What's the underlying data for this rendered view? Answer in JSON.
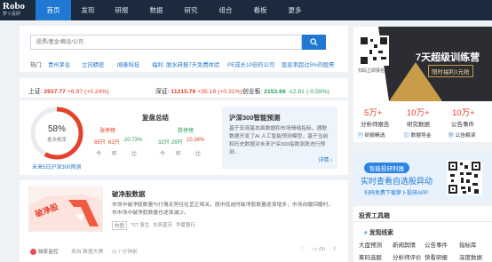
{
  "logo": {
    "text": "Robo",
    "sub": "萝卜投研"
  },
  "nav": {
    "items": [
      "首页",
      "发现",
      "研报",
      "数据",
      "研究",
      "组合",
      "看板",
      "更多"
    ],
    "active": 0
  },
  "search": {
    "placeholder": "股票/基金/概念/公司"
  },
  "hot": {
    "label": "热门:",
    "links": [
      "贵州茅台",
      "立讯精密",
      "闻泰科技",
      "福利: 脱水研报7天免费体验",
      "PE成长10倍的公司",
      "股息率超过5%的股票"
    ]
  },
  "indices": [
    {
      "name": "上证:",
      "value": "2937.77",
      "change": "+6.97",
      "pct": "(+0.24%)",
      "dir": "up"
    },
    {
      "name": "深证:",
      "value": "11215.76",
      "change": "+35.16",
      "pct": "(+0.31%)",
      "dir": "up"
    },
    {
      "name": "创业板:",
      "value": "2153.66",
      "change": "-12.81",
      "pct": "(-0.59%)",
      "dir": "down"
    }
  ],
  "gauge": {
    "percent": 58,
    "percent_text": "58%",
    "label": "看多概率",
    "footer": "未来5日沪深300预测",
    "arc_color": "#e5412c"
  },
  "review": {
    "title": "复盘总结",
    "up_label": "涨停榜",
    "up_value": "65只",
    "up_pct_label": "61只",
    "up_change": "-20.73%",
    "down_label": "跌停榜",
    "down_value": "32只",
    "down_pct_label": "29只",
    "down_change": "10.34%",
    "col_labels": [
      "今",
      "昨",
      "比",
      "今",
      "昨",
      "比"
    ]
  },
  "prediction": {
    "title": "沪深300智能预测",
    "text": "基于宏观基本面数据和市场情绪指标，通联数据开发了AI 人工智能预测模型，基于当前和历史数据对未来沪深300指数涨跌进行预测...",
    "more": "详情"
  },
  "news": {
    "image_text": "破净股",
    "title": "破净股数据",
    "text": "市场中破净股数量与行情走势往往呈正相关，股市低迷时破净股数量逐渐增多，市场向暖回暖时，市市场中破净股数量也逐渐减少。",
    "tags": [
      "构图",
      "*ST 复生",
      "东风蓝天",
      "华夏银行"
    ],
    "author": "独家监控",
    "source": "来自 数据大赛",
    "time": "7 分钟前",
    "count": "(9)"
  },
  "promo": {
    "banner": "7天超级训练营",
    "banner_sub": "限时福利1元抢",
    "qr_caption": "扫码立即报名"
  },
  "stats": [
    {
      "num": "5万+",
      "label": "分析师报告",
      "sub": "研报精选"
    },
    {
      "num": "10万+",
      "label": "研究数据",
      "sub": "数据导金"
    },
    {
      "num": "10万+",
      "label": "公告事件",
      "sub": "公告解读"
    }
  ],
  "ad": {
    "title": "智能投研利器",
    "line1": "实时查看自选股异动",
    "line2": "扫码免费下载萝卜投研APP"
  },
  "tools": {
    "head": "投资工具箱",
    "sub": "发现线索",
    "links": [
      [
        "大盘预测",
        "新闻舆情",
        "公告事件",
        "指标库"
      ],
      [
        "筹码选股",
        "分析师评价",
        "快看研报",
        "深度数据"
      ]
    ]
  }
}
